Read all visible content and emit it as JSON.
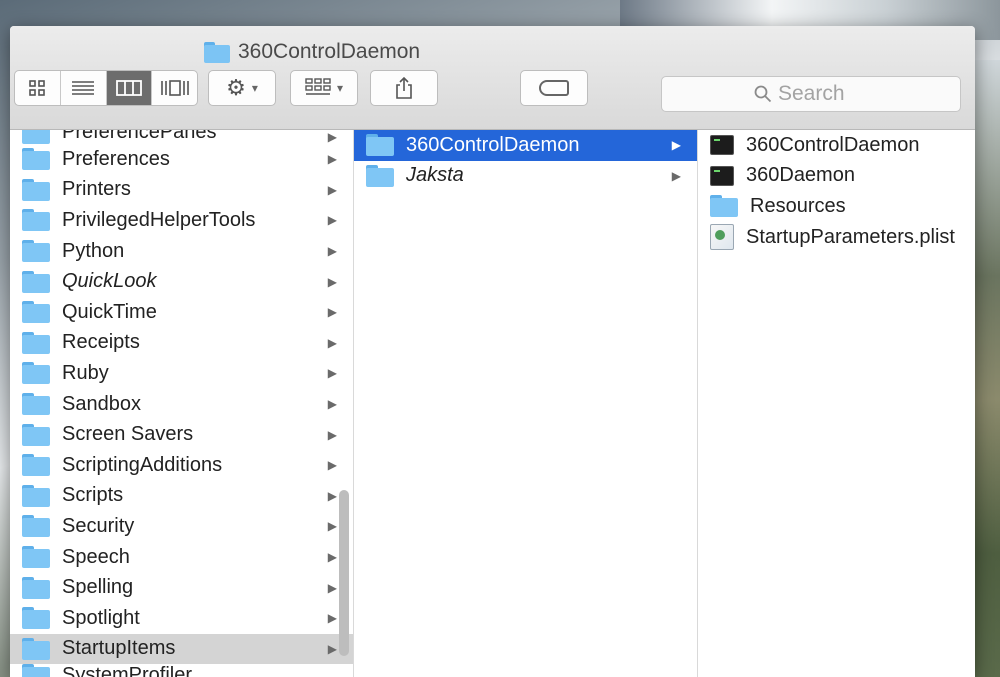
{
  "window": {
    "title": "360ControlDaemon"
  },
  "toolbar": {
    "view_icons": [
      "icon-view-icon",
      "list-view-icon",
      "column-view-icon",
      "coverflow-view-icon"
    ],
    "search": {
      "placeholder": "Search"
    }
  },
  "columns": {
    "col1": {
      "top_cut": "PreferencePanes",
      "items": [
        {
          "label": "Preferences",
          "italic": false
        },
        {
          "label": "Printers",
          "italic": false
        },
        {
          "label": "PrivilegedHelperTools",
          "italic": false
        },
        {
          "label": "Python",
          "italic": false
        },
        {
          "label": "QuickLook",
          "italic": true
        },
        {
          "label": "QuickTime",
          "italic": false
        },
        {
          "label": "Receipts",
          "italic": false
        },
        {
          "label": "Ruby",
          "italic": false
        },
        {
          "label": "Sandbox",
          "italic": false
        },
        {
          "label": "Screen Savers",
          "italic": false
        },
        {
          "label": "ScriptingAdditions",
          "italic": false
        },
        {
          "label": "Scripts",
          "italic": false
        },
        {
          "label": "Security",
          "italic": false
        },
        {
          "label": "Speech",
          "italic": false
        },
        {
          "label": "Spelling",
          "italic": false
        },
        {
          "label": "Spotlight",
          "italic": false
        },
        {
          "label": "StartupItems",
          "italic": false,
          "selected": true
        }
      ],
      "bottom_cut": "SystemProfiler"
    },
    "col2": {
      "items": [
        {
          "label": "360ControlDaemon",
          "italic": false,
          "selected": true
        },
        {
          "label": "Jaksta",
          "italic": true
        }
      ]
    },
    "col3": {
      "items": [
        {
          "label": "360ControlDaemon",
          "icon": "terminal"
        },
        {
          "label": "360Daemon",
          "icon": "terminal"
        },
        {
          "label": "Resources",
          "icon": "folder"
        },
        {
          "label": "StartupParameters.plist",
          "icon": "plist"
        }
      ]
    }
  },
  "colors": {
    "selection_blue": "#2466d9",
    "selection_gray": "#d4d4d4",
    "folder_blue": "#7fc6f5"
  }
}
